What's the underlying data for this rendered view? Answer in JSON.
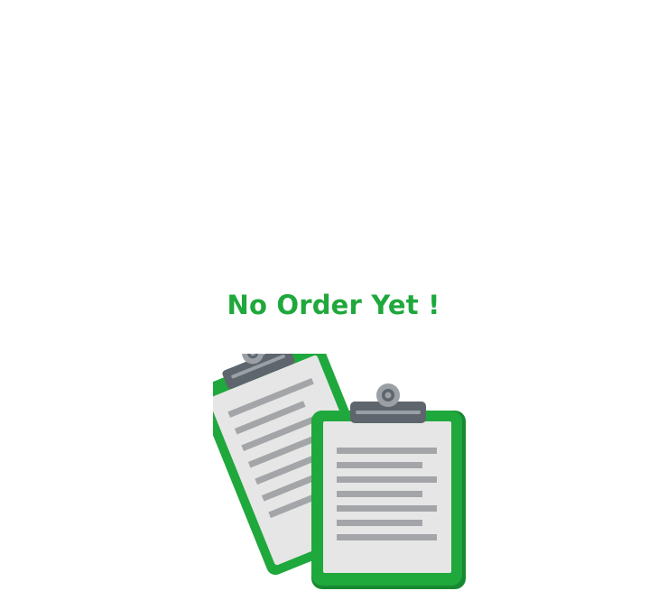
{
  "empty_state": {
    "title": "No Order Yet !",
    "illustration": "clipboard-icon",
    "colors": {
      "title": "#1fa83c",
      "clipboard_frame": "#1fa83c",
      "clipboard_frame_dark": "#178a31",
      "paper": "#e6e6e6",
      "lines": "#a3a5a8",
      "clip": "#5e656d",
      "clip_light": "#9aa0a6"
    }
  }
}
